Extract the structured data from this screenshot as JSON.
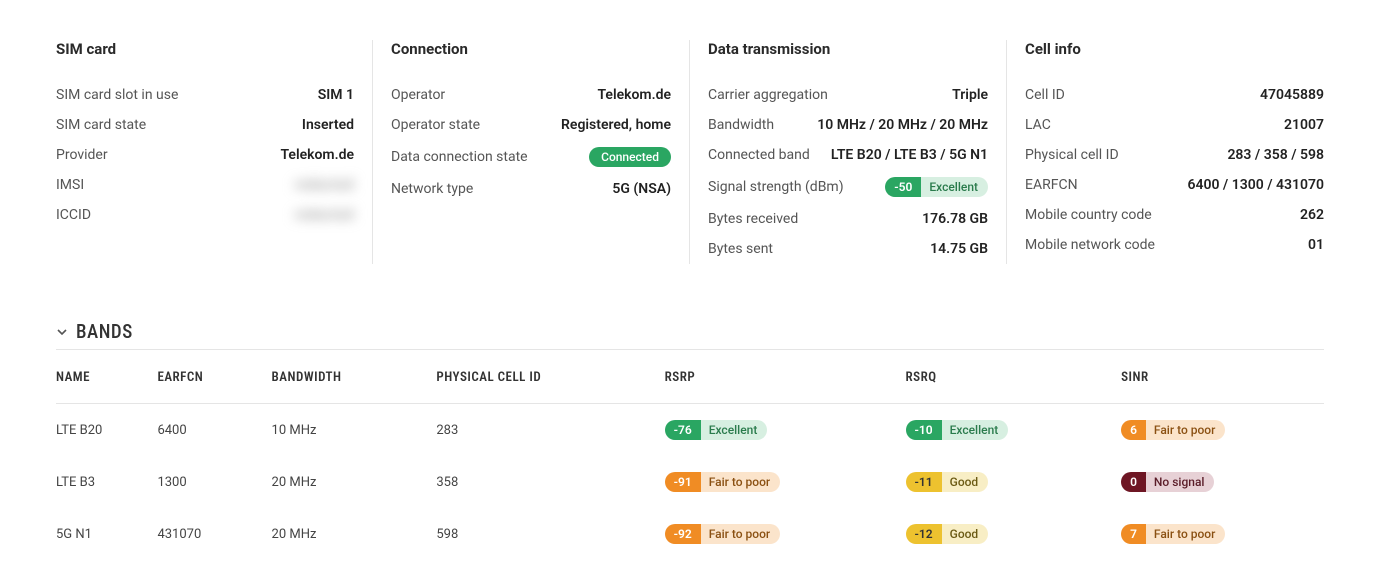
{
  "panels": {
    "sim": {
      "title": "SIM card",
      "rows": {
        "slot": {
          "label": "SIM card slot in use",
          "value": "SIM 1"
        },
        "state": {
          "label": "SIM card state",
          "value": "Inserted"
        },
        "provider": {
          "label": "Provider",
          "value": "Telekom.de"
        },
        "imsi": {
          "label": "IMSI",
          "value": "redacted"
        },
        "iccid": {
          "label": "ICCID",
          "value": "redacted"
        }
      }
    },
    "conn": {
      "title": "Connection",
      "rows": {
        "operator": {
          "label": "Operator",
          "value": "Telekom.de"
        },
        "operator_state": {
          "label": "Operator state",
          "value": "Registered, home"
        },
        "data_state": {
          "label": "Data connection state",
          "value": "Connected"
        },
        "net_type": {
          "label": "Network type",
          "value": "5G (NSA)"
        }
      }
    },
    "data": {
      "title": "Data transmission",
      "rows": {
        "ca": {
          "label": "Carrier aggregation",
          "value": "Triple"
        },
        "bw": {
          "label": "Bandwidth",
          "value": "10 MHz / 20 MHz / 20 MHz"
        },
        "band": {
          "label": "Connected band",
          "value": "LTE B20 / LTE B3 / 5G N1"
        },
        "signal": {
          "label": "Signal strength (dBm)",
          "pill": {
            "value": "-50",
            "text": "Excellent",
            "color": "green"
          }
        },
        "rx": {
          "label": "Bytes received",
          "value": "176.78 GB"
        },
        "tx": {
          "label": "Bytes sent",
          "value": "14.75 GB"
        }
      }
    },
    "cell": {
      "title": "Cell info",
      "rows": {
        "cellid": {
          "label": "Cell ID",
          "value": "47045889"
        },
        "lac": {
          "label": "LAC",
          "value": "21007"
        },
        "pci": {
          "label": "Physical cell ID",
          "value": "283 / 358 / 598"
        },
        "earfcn": {
          "label": "EARFCN",
          "value": "6400 / 1300 / 431070"
        },
        "mcc": {
          "label": "Mobile country code",
          "value": "262"
        },
        "mnc": {
          "label": "Mobile network code",
          "value": "01"
        }
      }
    }
  },
  "bands_section": {
    "title": "BANDS"
  },
  "bands_headers": {
    "name": "NAME",
    "earfcn": "EARFCN",
    "bandwidth": "BANDWIDTH",
    "pci": "PHYSICAL CELL ID",
    "rsrp": "RSRP",
    "rsrq": "RSRQ",
    "sinr": "SINR"
  },
  "bands": [
    {
      "name": "LTE B20",
      "earfcn": "6400",
      "bandwidth": "10 MHz",
      "pci": "283",
      "rsrp": {
        "value": "-76",
        "text": "Excellent",
        "color": "green"
      },
      "rsrq": {
        "value": "-10",
        "text": "Excellent",
        "color": "green"
      },
      "sinr": {
        "value": "6",
        "text": "Fair to poor",
        "color": "orange"
      }
    },
    {
      "name": "LTE B3",
      "earfcn": "1300",
      "bandwidth": "20 MHz",
      "pci": "358",
      "rsrp": {
        "value": "-91",
        "text": "Fair to poor",
        "color": "orange"
      },
      "rsrq": {
        "value": "-11",
        "text": "Good",
        "color": "yellow"
      },
      "sinr": {
        "value": "0",
        "text": "No signal",
        "color": "darkred"
      }
    },
    {
      "name": "5G N1",
      "earfcn": "431070",
      "bandwidth": "20 MHz",
      "pci": "598",
      "rsrp": {
        "value": "-92",
        "text": "Fair to poor",
        "color": "orange"
      },
      "rsrq": {
        "value": "-12",
        "text": "Good",
        "color": "yellow"
      },
      "sinr": {
        "value": "7",
        "text": "Fair to poor",
        "color": "orange"
      }
    }
  ]
}
